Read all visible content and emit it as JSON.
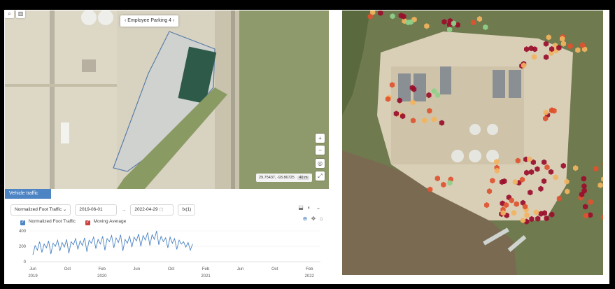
{
  "left_map": {
    "location_label": "Employee Parking 4",
    "coordinates": "29.75437, -93.86725",
    "zoom_pill": "40 m"
  },
  "panel": {
    "tab_label": "Vehicle traffic",
    "metric_select": "Normalized Foot Traffic",
    "start_date": "2019-06-01",
    "end_date": "2022-04-29",
    "fx_label": "fx(1)",
    "legend": [
      {
        "label": "Normalized Foot Traffic",
        "color": "#4d84c4"
      },
      {
        "label": "Moving Average",
        "color": "#c9423f"
      }
    ]
  },
  "colors": {
    "series": "#4d84c4",
    "hex_low": "#8fd08a",
    "hex_mid": "#f2b35e",
    "hex_high": "#e0522f",
    "hex_max": "#9a0d2b"
  },
  "chart_data": {
    "type": "line",
    "ylim": [
      0,
      400
    ],
    "y_ticks": [
      "400",
      "200",
      "0"
    ],
    "x_ticks": [
      {
        "label": "Jun",
        "year": "2019"
      },
      {
        "label": "Oct",
        "year": ""
      },
      {
        "label": "Feb",
        "year": "2020"
      },
      {
        "label": "Jun",
        "year": ""
      },
      {
        "label": "Oct",
        "year": ""
      },
      {
        "label": "Feb",
        "year": "2021"
      },
      {
        "label": "Jun",
        "year": ""
      },
      {
        "label": "Oct",
        "year": ""
      },
      {
        "label": "Feb",
        "year": "2022"
      }
    ],
    "series": [
      {
        "name": "Normalized Foot Traffic",
        "values": [
          90,
          210,
          150,
          260,
          120,
          230,
          180,
          270,
          100,
          240,
          200,
          280,
          140,
          250,
          190,
          290,
          110,
          260,
          220,
          300,
          160,
          270,
          210,
          310,
          130,
          280,
          240,
          320,
          170,
          290,
          230,
          330,
          150,
          300,
          260,
          340,
          180,
          310,
          250,
          350,
          140,
          290,
          240,
          330,
          190,
          320,
          270,
          360,
          200,
          340,
          280,
          380,
          210,
          350,
          290,
          400,
          220,
          330,
          260,
          310,
          180,
          320,
          240,
          300,
          160,
          280,
          230,
          260,
          190,
          250,
          150,
          230
        ]
      }
    ]
  }
}
